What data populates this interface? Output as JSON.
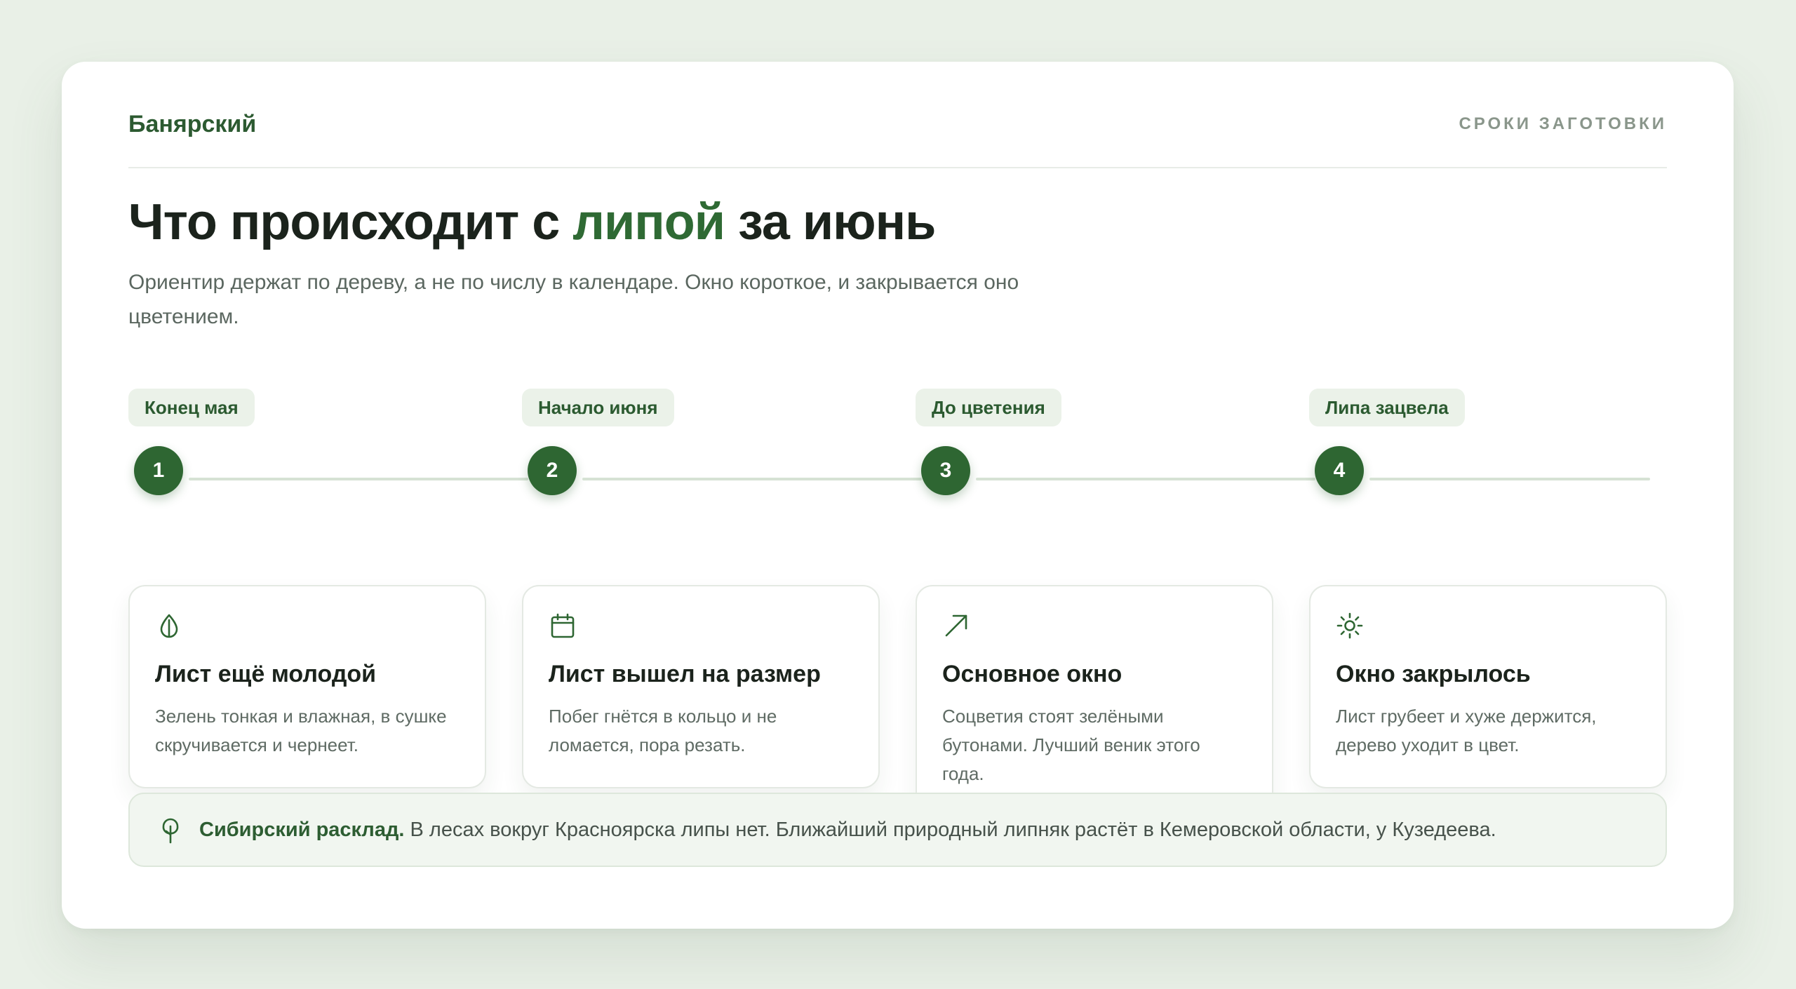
{
  "header": {
    "brand": "Банярский",
    "nav_link": "СРОКИ ЗАГОТОВКИ"
  },
  "hero": {
    "title_before": "Что происходит с ",
    "title_accent": "липой",
    "title_after": " за июнь",
    "subtitle": "Ориентир держат по дереву, а не по числу в календаре. Окно короткое, и закрывается оно цветением."
  },
  "steps": [
    {
      "tag": "Конец мая",
      "number": "1",
      "icon": "leaf-drop-icon",
      "title": "Лист ещё молодой",
      "text": "Зелень тонкая и влажная, в сушке скручивается и чернеет."
    },
    {
      "tag": "Начало июня",
      "number": "2",
      "icon": "calendar-icon",
      "title": "Лист вышел на размер",
      "text": "Побег гнётся в кольцо и не ломается, пора резать."
    },
    {
      "tag": "До цветения",
      "number": "3",
      "icon": "arrow-up-right-icon",
      "title": "Основное окно",
      "text": "Соцветия стоят зелёными бутонами. Лучший веник этого года."
    },
    {
      "tag": "Липа зацвела",
      "number": "4",
      "icon": "sun-icon",
      "title": "Окно закрылось",
      "text": "Лист грубеет и хуже держится, дерево уходит в цвет."
    }
  ],
  "note": {
    "icon": "tree-icon",
    "lead": "Сибирский расклад.",
    "text": " В лесах вокруг Красноярска липы нет. Ближайший природный липняк растёт в Кемеровской области, у Кузедеева."
  },
  "colors": {
    "accent": "#2f6a34",
    "badge_bg": "#ebf2e9",
    "page_bg": "#e9f0e7"
  }
}
